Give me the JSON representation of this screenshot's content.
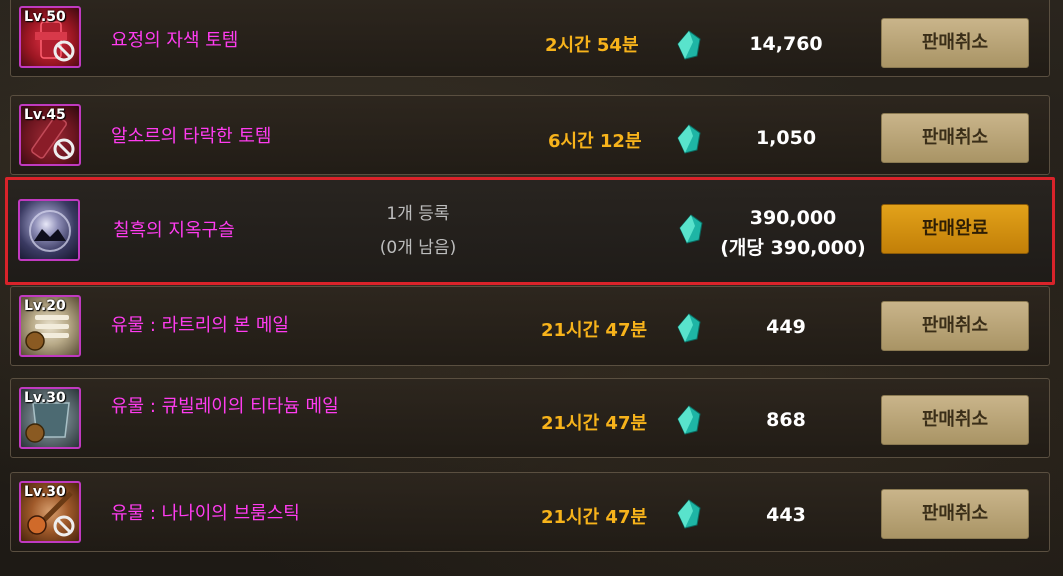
{
  "rows": [
    {
      "level": "Lv.50",
      "name": "요정의 자색 토템",
      "time": "2시간 54분",
      "price": "14,760",
      "button": "판매취소"
    },
    {
      "level": "Lv.45",
      "name": "알소르의 타락한 토템",
      "time": "6시간 12분",
      "price": "1,050",
      "button": "판매취소"
    },
    {
      "level": "",
      "name": "칠흑의 지옥구슬",
      "registered": "1개 등록",
      "remaining": "(0개 남음)",
      "price": "390,000",
      "unit_price": "(개당 390,000)",
      "button": "판매완료"
    },
    {
      "level": "Lv.20",
      "name": "유물 : 라트리의 본 메일",
      "time": "21시간 47분",
      "price": "449",
      "button": "판매취소"
    },
    {
      "level": "Lv.30",
      "name": "유물 : 큐빌레이의 티타늄 메일",
      "time": "21시간 47분",
      "price": "868",
      "button": "판매취소"
    },
    {
      "level": "Lv.30",
      "name": "유물 : 나나이의 브룸스틱",
      "time": "21시간 47분",
      "price": "443",
      "button": "판매취소"
    }
  ],
  "colors": {
    "name": "#ff3cf0",
    "time": "#f7b31b",
    "highlight_border": "#d9232a",
    "cancel_button": "#c9b48a",
    "complete_button": "#e2a21a"
  },
  "icons": {
    "currency": "gem-icon",
    "restricted": "ban-icon"
  }
}
